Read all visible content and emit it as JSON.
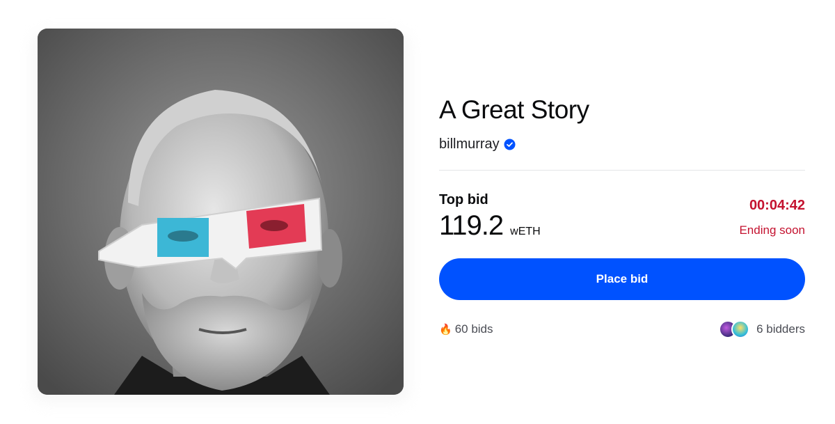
{
  "nft": {
    "title": "A Great Story",
    "creator": "billmurray",
    "verified_icon": "verified-badge-icon"
  },
  "auction": {
    "top_bid_label": "Top bid",
    "amount": "119.2",
    "currency": "wETH",
    "timer": "00:04:42",
    "status": "Ending soon",
    "place_bid_label": "Place bid",
    "bids_count": "60 bids",
    "bids_icon": "fire-icon",
    "bidders_count": "6 bidders"
  },
  "colors": {
    "accent": "#0052ff",
    "urgent": "#c4122f"
  }
}
